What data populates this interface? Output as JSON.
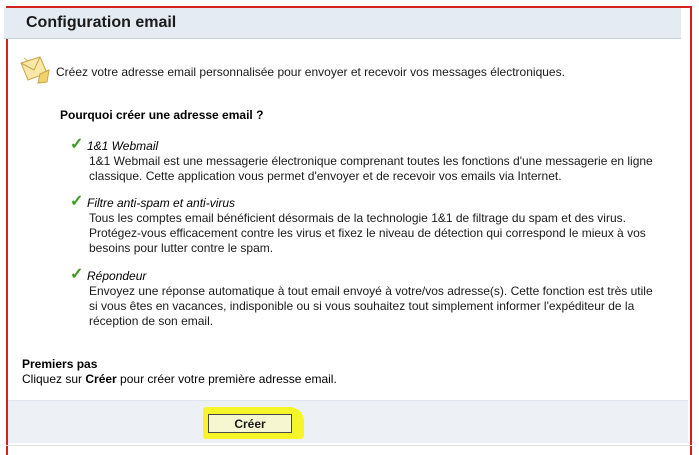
{
  "header": {
    "title": "Configuration email"
  },
  "intro": {
    "icon": "mail-envelope-icon",
    "text": "Créez votre adresse email personnalisée pour envoyer et recevoir vos messages électroniques."
  },
  "why": {
    "heading": "Pourquoi créer une adresse email ?",
    "features": [
      {
        "icon": "check-icon",
        "title": "1&1 Webmail",
        "description": "1&1 Webmail est une messagerie électronique comprenant toutes les fonctions d'une messagerie en ligne classique. Cette application vous permet d'envoyer et de recevoir vos emails via Internet."
      },
      {
        "icon": "check-icon",
        "title": "Filtre anti-spam et anti-virus",
        "description": "Tous les comptes email bénéficient désormais de la technologie 1&1 de filtrage du spam et des virus. Protégez-vous efficacement contre les virus et fixez le niveau de détection qui correspond le mieux à vos besoins pour lutter contre le spam."
      },
      {
        "icon": "check-icon",
        "title": "Répondeur",
        "description": "Envoyez une réponse automatique à tout email envoyé à votre/vos adresse(s). Cette fonction est très utile si vous êtes en vacances, indisponible ou si vous souhaitez tout simplement informer l'expéditeur de la réception de son email."
      }
    ]
  },
  "steps": {
    "title": "Premiers pas",
    "text_before": "Cliquez sur ",
    "text_bold": "Créer",
    "text_after": " pour créer votre première adresse email."
  },
  "actions": {
    "create_label": "Créer"
  },
  "colors": {
    "frame": "#d42020",
    "header_bg": "#e5ebf3",
    "check": "#3e9a1e",
    "highlight": "#f5f52a"
  }
}
